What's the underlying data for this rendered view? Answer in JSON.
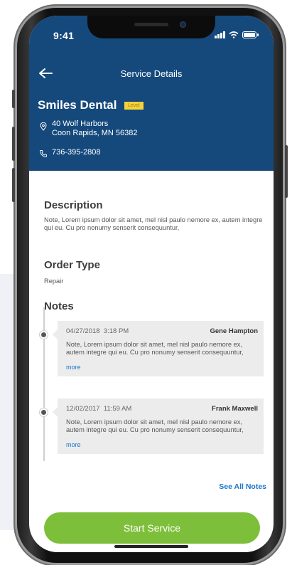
{
  "status_bar": {
    "time": "9:41"
  },
  "nav": {
    "back_icon": "arrow-left-icon",
    "title": "Service Details"
  },
  "business": {
    "name": "Smiles Dental",
    "badge": "Level",
    "address_line1": "40 Wolf Harbors",
    "address_line2": "Coon Rapids, MN 56382",
    "phone": "736-395-2808"
  },
  "description": {
    "heading": "Description",
    "text": "Note, Lorem ipsum dolor sit amet, mel nisl paulo nemore ex, autem integre qui eu. Cu pro nonumy senserit consequuntur,"
  },
  "order_type": {
    "heading": "Order Type",
    "value": "Repair"
  },
  "notes": {
    "heading": "Notes",
    "items": [
      {
        "date": "04/27/2018",
        "time": "3:18 PM",
        "author": "Gene Hampton",
        "text": "Note, Lorem ipsum dolor sit amet, mel nisl paulo nemore ex, autem integre qui eu. Cu pro nonumy senserit consequuntur,",
        "more": "more"
      },
      {
        "date": "12/02/2017",
        "time": "11:59 AM",
        "author": "Frank Maxwell",
        "text": "Note, Lorem ipsum dolor sit amet, mel nisl paulo nemore ex, autem integre qui eu. Cu pro nonumy senserit consequuntur,",
        "more": "more"
      }
    ],
    "see_all": "See All Notes"
  },
  "actions": {
    "start_service": "Start Service"
  },
  "colors": {
    "header_bg": "#15497c",
    "badge": "#f3d23a",
    "link": "#1a76c8",
    "primary_button": "#7dbf3a"
  }
}
